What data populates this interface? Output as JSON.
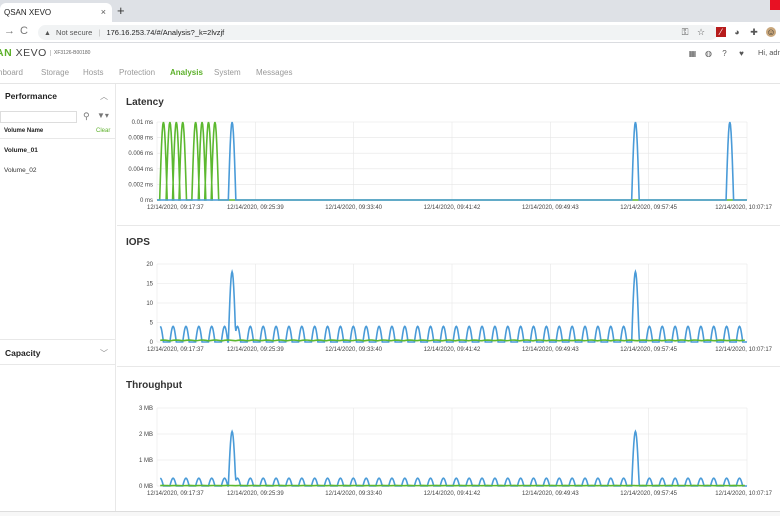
{
  "browser": {
    "tab_title": "QSAN XEVO",
    "tab_close": "×",
    "new_tab": "+",
    "back": "→",
    "reload": "C",
    "security_icon": "▲",
    "security_text": "Not secure",
    "url": "176.16.253.74/#/Analysis?_k=2lvzjf"
  },
  "app": {
    "logo_left": "AN",
    "logo_right": "XEVO",
    "model": "XF3126-B00180",
    "greeting": "Hi, adm"
  },
  "nav": {
    "items": [
      "hboard",
      "Storage",
      "Hosts",
      "Protection",
      "Analysis",
      "System",
      "Messages"
    ],
    "active": "Analysis"
  },
  "sidebar": {
    "performance_title": "Performance",
    "volume_header": "Volume Name",
    "clear_label": "Clear",
    "volumes": [
      "Volume_01",
      "Volume_02"
    ],
    "selected_volume": "Volume_01",
    "capacity_title": "Capacity"
  },
  "colors": {
    "accent_green": "#5cb02a",
    "series_blue": "#4a9bd8",
    "series_green": "#5cb82f"
  },
  "chart_data": [
    {
      "type": "line",
      "title": "Latency",
      "y_ticks": [
        "0 ms",
        "0.002 ms",
        "0.004 ms",
        "0.006 ms",
        "0.008 ms",
        "0.01 ms"
      ],
      "ylim": [
        0,
        0.01
      ],
      "x_ticks": [
        "12/14/2020, 09:17:37",
        "12/14/2020, 09:25:39",
        "12/14/2020, 09:33:40",
        "12/14/2020, 09:41:42",
        "12/14/2020, 09:49:43",
        "12/14/2020, 09:57:45",
        "12/14/2020, 10:07:17"
      ],
      "grid": true,
      "series": [
        {
          "color": "green",
          "peaks_at": [
            0.6,
            1.2,
            1.8,
            2.4,
            3.6,
            4.2,
            4.8,
            5.4
          ],
          "peak_value": 0.01
        },
        {
          "color": "blue",
          "peaks_at": [
            7.0,
            44.6,
            53.4
          ],
          "peak_value": 0.01
        }
      ]
    },
    {
      "type": "line",
      "title": "IOPS",
      "y_ticks": [
        "0",
        "5",
        "10",
        "15",
        "20"
      ],
      "ylim": [
        0,
        20
      ],
      "x_ticks": [
        "12/14/2020, 09:17:37",
        "12/14/2020, 09:25:39",
        "12/14/2020, 09:33:40",
        "12/14/2020, 09:41:42",
        "12/14/2020, 09:49:43",
        "12/14/2020, 09:57:45",
        "12/14/2020, 10:07:17"
      ],
      "grid": true,
      "series": [
        {
          "color": "blue",
          "baseline_oscillation": [
            0,
            4
          ],
          "spikes": [
            {
              "at": 7.0,
              "value": 18
            },
            {
              "at": 44.6,
              "value": 18
            }
          ]
        },
        {
          "color": "green",
          "value": 0.5
        }
      ]
    },
    {
      "type": "line",
      "title": "Throughput",
      "y_ticks": [
        "0 MB",
        "1 MB",
        "2 MB",
        "3 MB"
      ],
      "ylim": [
        0,
        3
      ],
      "x_ticks": [
        "12/14/2020, 09:17:37",
        "12/14/2020, 09:25:39",
        "12/14/2020, 09:33:40",
        "12/14/2020, 09:41:42",
        "12/14/2020, 09:49:43",
        "12/14/2020, 09:57:45",
        "12/14/2020, 10:07:17"
      ],
      "grid": true,
      "series": [
        {
          "color": "blue",
          "baseline_oscillation": [
            0,
            0.3
          ],
          "spikes": [
            {
              "at": 7.0,
              "value": 2.1
            },
            {
              "at": 44.6,
              "value": 2.1
            }
          ]
        },
        {
          "color": "green",
          "value": 0.02
        }
      ]
    }
  ]
}
